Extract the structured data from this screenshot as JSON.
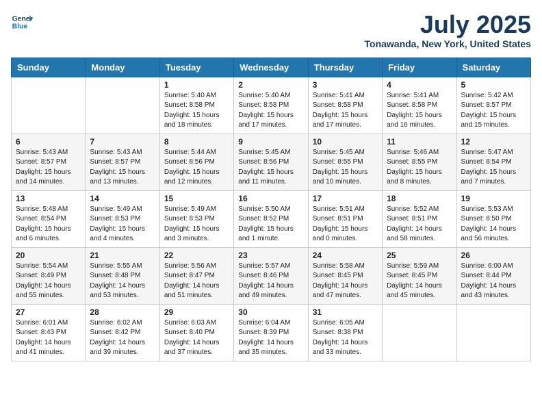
{
  "header": {
    "logo_line1": "General",
    "logo_line2": "Blue",
    "month_year": "July 2025",
    "location": "Tonawanda, New York, United States"
  },
  "days_of_week": [
    "Sunday",
    "Monday",
    "Tuesday",
    "Wednesday",
    "Thursday",
    "Friday",
    "Saturday"
  ],
  "weeks": [
    [
      {
        "day": "",
        "info": ""
      },
      {
        "day": "",
        "info": ""
      },
      {
        "day": "1",
        "info": "Sunrise: 5:40 AM\nSunset: 8:58 PM\nDaylight: 15 hours\nand 18 minutes."
      },
      {
        "day": "2",
        "info": "Sunrise: 5:40 AM\nSunset: 8:58 PM\nDaylight: 15 hours\nand 17 minutes."
      },
      {
        "day": "3",
        "info": "Sunrise: 5:41 AM\nSunset: 8:58 PM\nDaylight: 15 hours\nand 17 minutes."
      },
      {
        "day": "4",
        "info": "Sunrise: 5:41 AM\nSunset: 8:58 PM\nDaylight: 15 hours\nand 16 minutes."
      },
      {
        "day": "5",
        "info": "Sunrise: 5:42 AM\nSunset: 8:57 PM\nDaylight: 15 hours\nand 15 minutes."
      }
    ],
    [
      {
        "day": "6",
        "info": "Sunrise: 5:43 AM\nSunset: 8:57 PM\nDaylight: 15 hours\nand 14 minutes."
      },
      {
        "day": "7",
        "info": "Sunrise: 5:43 AM\nSunset: 8:57 PM\nDaylight: 15 hours\nand 13 minutes."
      },
      {
        "day": "8",
        "info": "Sunrise: 5:44 AM\nSunset: 8:56 PM\nDaylight: 15 hours\nand 12 minutes."
      },
      {
        "day": "9",
        "info": "Sunrise: 5:45 AM\nSunset: 8:56 PM\nDaylight: 15 hours\nand 11 minutes."
      },
      {
        "day": "10",
        "info": "Sunrise: 5:45 AM\nSunset: 8:55 PM\nDaylight: 15 hours\nand 10 minutes."
      },
      {
        "day": "11",
        "info": "Sunrise: 5:46 AM\nSunset: 8:55 PM\nDaylight: 15 hours\nand 8 minutes."
      },
      {
        "day": "12",
        "info": "Sunrise: 5:47 AM\nSunset: 8:54 PM\nDaylight: 15 hours\nand 7 minutes."
      }
    ],
    [
      {
        "day": "13",
        "info": "Sunrise: 5:48 AM\nSunset: 8:54 PM\nDaylight: 15 hours\nand 6 minutes."
      },
      {
        "day": "14",
        "info": "Sunrise: 5:49 AM\nSunset: 8:53 PM\nDaylight: 15 hours\nand 4 minutes."
      },
      {
        "day": "15",
        "info": "Sunrise: 5:49 AM\nSunset: 8:53 PM\nDaylight: 15 hours\nand 3 minutes."
      },
      {
        "day": "16",
        "info": "Sunrise: 5:50 AM\nSunset: 8:52 PM\nDaylight: 15 hours\nand 1 minute."
      },
      {
        "day": "17",
        "info": "Sunrise: 5:51 AM\nSunset: 8:51 PM\nDaylight: 15 hours\nand 0 minutes."
      },
      {
        "day": "18",
        "info": "Sunrise: 5:52 AM\nSunset: 8:51 PM\nDaylight: 14 hours\nand 58 minutes."
      },
      {
        "day": "19",
        "info": "Sunrise: 5:53 AM\nSunset: 8:50 PM\nDaylight: 14 hours\nand 56 minutes."
      }
    ],
    [
      {
        "day": "20",
        "info": "Sunrise: 5:54 AM\nSunset: 8:49 PM\nDaylight: 14 hours\nand 55 minutes."
      },
      {
        "day": "21",
        "info": "Sunrise: 5:55 AM\nSunset: 8:48 PM\nDaylight: 14 hours\nand 53 minutes."
      },
      {
        "day": "22",
        "info": "Sunrise: 5:56 AM\nSunset: 8:47 PM\nDaylight: 14 hours\nand 51 minutes."
      },
      {
        "day": "23",
        "info": "Sunrise: 5:57 AM\nSunset: 8:46 PM\nDaylight: 14 hours\nand 49 minutes."
      },
      {
        "day": "24",
        "info": "Sunrise: 5:58 AM\nSunset: 8:45 PM\nDaylight: 14 hours\nand 47 minutes."
      },
      {
        "day": "25",
        "info": "Sunrise: 5:59 AM\nSunset: 8:45 PM\nDaylight: 14 hours\nand 45 minutes."
      },
      {
        "day": "26",
        "info": "Sunrise: 6:00 AM\nSunset: 8:44 PM\nDaylight: 14 hours\nand 43 minutes."
      }
    ],
    [
      {
        "day": "27",
        "info": "Sunrise: 6:01 AM\nSunset: 8:43 PM\nDaylight: 14 hours\nand 41 minutes."
      },
      {
        "day": "28",
        "info": "Sunrise: 6:02 AM\nSunset: 8:42 PM\nDaylight: 14 hours\nand 39 minutes."
      },
      {
        "day": "29",
        "info": "Sunrise: 6:03 AM\nSunset: 8:40 PM\nDaylight: 14 hours\nand 37 minutes."
      },
      {
        "day": "30",
        "info": "Sunrise: 6:04 AM\nSunset: 8:39 PM\nDaylight: 14 hours\nand 35 minutes."
      },
      {
        "day": "31",
        "info": "Sunrise: 6:05 AM\nSunset: 8:38 PM\nDaylight: 14 hours\nand 33 minutes."
      },
      {
        "day": "",
        "info": ""
      },
      {
        "day": "",
        "info": ""
      }
    ]
  ]
}
